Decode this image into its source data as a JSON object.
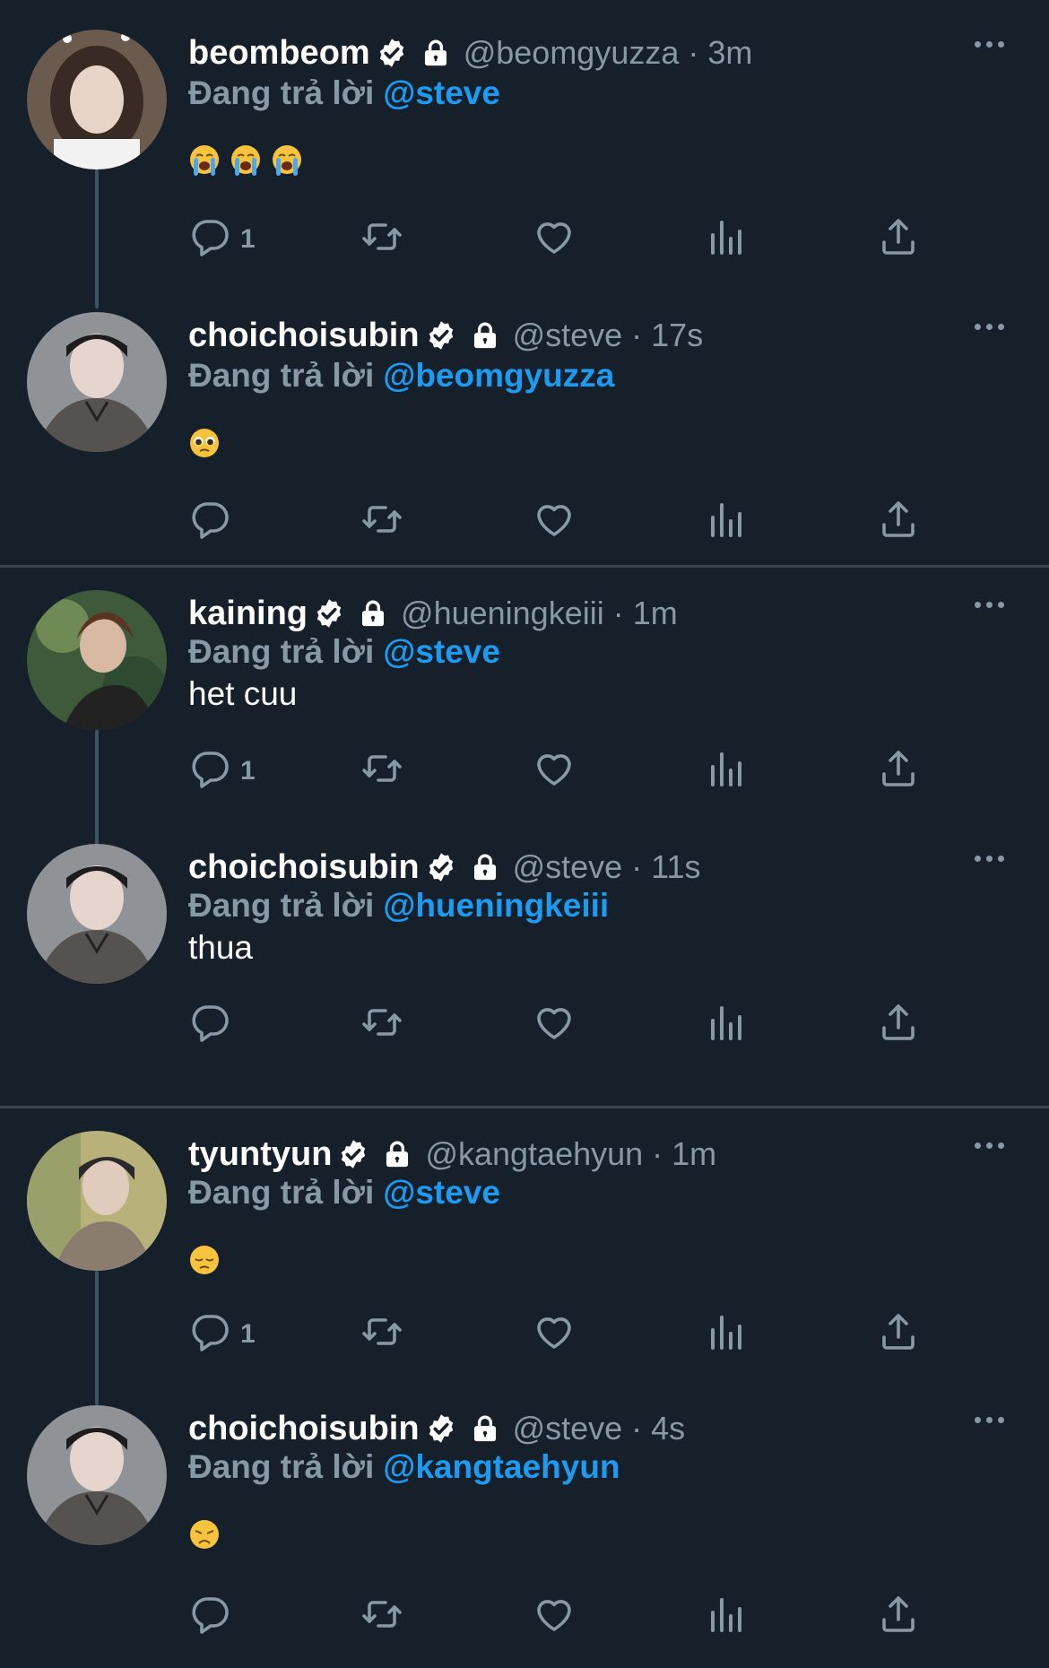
{
  "reply_prefix": "Đang trả lời",
  "colors": {
    "background": "#15202b",
    "muted": "#8899a6",
    "accent": "#1d9bf0",
    "divider": "#38444d"
  },
  "icons": {
    "verified": "verified-badge-icon",
    "lock": "lock-icon",
    "more": "more-options-icon",
    "reply": "reply-icon",
    "retweet": "retweet-icon",
    "like": "heart-icon",
    "views": "views-icon",
    "share": "share-icon"
  },
  "tweets": [
    {
      "name": "beombeom",
      "handle": "@beomgyuzza",
      "sep": "·",
      "time": "3m",
      "reply_to": "@steve",
      "text": "",
      "emojis": [
        "😭",
        "😭",
        "😭"
      ],
      "reply_count": "1"
    },
    {
      "name": "choichoisubin",
      "handle": "@steve",
      "sep": "·",
      "time": "17s",
      "reply_to": "@beomgyuzza",
      "text": "",
      "emojis": [
        "🥹"
      ],
      "reply_count": ""
    },
    {
      "name": "kaining",
      "handle": "@hueningkeiii",
      "sep": "·",
      "time": "1m",
      "reply_to": "@steve",
      "text": "het cuu",
      "emojis": [],
      "reply_count": "1"
    },
    {
      "name": "choichoisubin",
      "handle": "@steve",
      "sep": "·",
      "time": "11s",
      "reply_to": "@hueningkeiii",
      "text": "thua",
      "emojis": [],
      "reply_count": ""
    },
    {
      "name": "tyuntyun",
      "handle": "@kangtaehyun",
      "sep": "·",
      "time": "1m",
      "reply_to": "@steve",
      "text": "",
      "emojis": [
        "😔"
      ],
      "reply_count": "1"
    },
    {
      "name": "choichoisubin",
      "handle": "@steve",
      "sep": "·",
      "time": "4s",
      "reply_to": "@kangtaehyun",
      "text": "",
      "emojis": [
        "😞"
      ],
      "reply_count": ""
    }
  ]
}
